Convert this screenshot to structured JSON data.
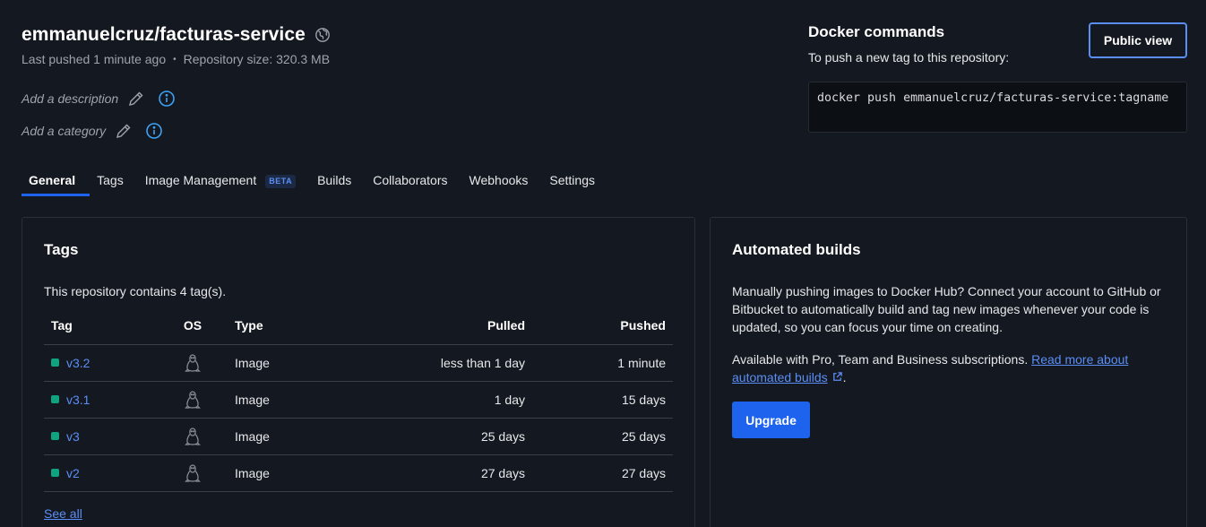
{
  "repo": {
    "title": "emmanuelcruz/facturas-service",
    "visibility_icon": "globe-icon",
    "last_pushed": "Last pushed 1 minute ago",
    "separator": "•",
    "size": "Repository size: 320.3 MB",
    "description_placeholder": "Add a description",
    "category_placeholder": "Add a category"
  },
  "docker": {
    "title": "Docker commands",
    "subtitle": "To push a new tag to this repository:",
    "command": "docker push emmanuelcruz/facturas-service:tagname",
    "public_view_label": "Public view"
  },
  "tabs": [
    {
      "label": "General",
      "active": true
    },
    {
      "label": "Tags"
    },
    {
      "label": "Image Management",
      "badge": "BETA"
    },
    {
      "label": "Builds"
    },
    {
      "label": "Collaborators"
    },
    {
      "label": "Webhooks"
    },
    {
      "label": "Settings"
    }
  ],
  "tags_panel": {
    "title": "Tags",
    "count_text": "This repository contains 4 tag(s).",
    "columns": [
      "Tag",
      "OS",
      "Type",
      "Pulled",
      "Pushed"
    ],
    "rows": [
      {
        "tag": "v3.2",
        "os": "linux-icon",
        "type": "Image",
        "pulled": "less than 1 day",
        "pushed": "1 minute"
      },
      {
        "tag": "v3.1",
        "os": "linux-icon",
        "type": "Image",
        "pulled": "1 day",
        "pushed": "15 days"
      },
      {
        "tag": "v3",
        "os": "linux-icon",
        "type": "Image",
        "pulled": "25 days",
        "pushed": "25 days"
      },
      {
        "tag": "v2",
        "os": "linux-icon",
        "type": "Image",
        "pulled": "27 days",
        "pushed": "27 days"
      }
    ],
    "see_all": "See all"
  },
  "builds_panel": {
    "title": "Automated builds",
    "description": "Manually pushing images to Docker Hub? Connect your account to GitHub or Bitbucket to automatically build and tag new images whenever your code is updated, so you can focus your time on creating.",
    "availability": "Available with Pro, Team and Business subscriptions.",
    "read_more": "Read more about automated builds",
    "period": ".",
    "upgrade_label": "Upgrade"
  },
  "colors": {
    "background": "#141820",
    "accent": "#1d63ed",
    "link": "#5b8ef5",
    "tag_status": "#10a37f"
  }
}
